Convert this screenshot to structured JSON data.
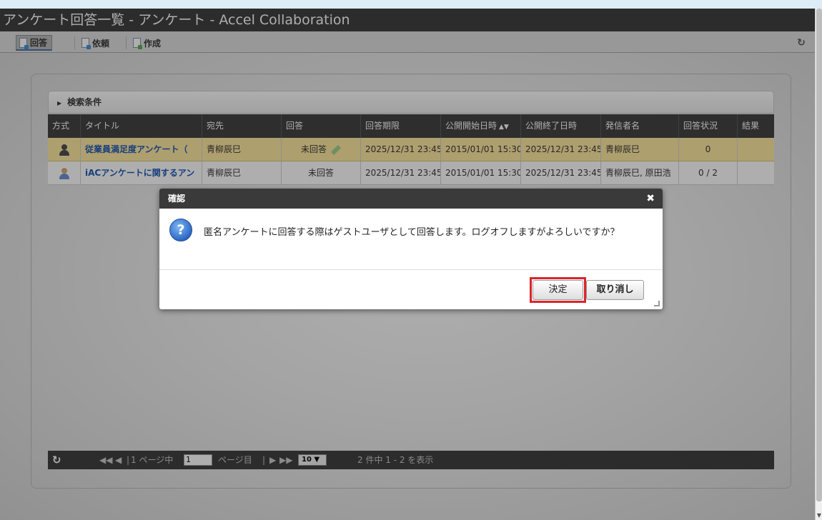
{
  "window": {
    "title": "アンケート回答一覧 - アンケート - Accel Collaboration"
  },
  "tabs": [
    {
      "label": "回答",
      "active": true
    },
    {
      "label": "依頼",
      "active": false
    },
    {
      "label": "作成",
      "active": false
    }
  ],
  "search": {
    "label": "検索条件"
  },
  "grid": {
    "columns": [
      "方式",
      "タイトル",
      "宛先",
      "回答",
      "回答期限",
      "公開開始日時",
      "公開終了日時",
      "発信者名",
      "回答状況",
      "結果"
    ],
    "sort_icon": "sort-icon",
    "rows": [
      {
        "method_icon": "person-icon",
        "title": "従業員満足度アンケート（",
        "recipient": "青柳辰巳",
        "answer": "未回答",
        "deadline": "2025/12/31 23:45",
        "start": "2015/01/01 15:30",
        "end": "2025/12/31 23:45",
        "sender": "青柳辰巳",
        "status": "0",
        "result": ""
      },
      {
        "method_icon": "person-icon",
        "title": "iACアンケートに関するアン",
        "recipient": "青柳辰巳",
        "answer": "未回答",
        "deadline": "2025/12/31 23:45",
        "start": "2015/01/01 15:30",
        "end": "2025/12/31 23:45",
        "sender": "青柳辰巳, 原田浩",
        "status": "0 / 2",
        "result": ""
      }
    ]
  },
  "pager": {
    "page_prefix": "1 ページ中",
    "page_value": "1",
    "page_suffix": "ページ目",
    "page_size": "10 ▼",
    "summary": "2 件中 1 - 2 を表示"
  },
  "dialog": {
    "title": "確認",
    "close": "✖",
    "message": "匿名アンケートに回答する際はゲストユーザとして回答します。ログオフしますがよろしいですか？",
    "ok_label": "決定",
    "cancel_label": "取り消し"
  },
  "colors": {
    "highlight": "#d9262c",
    "row_selected": "#ffe8a0",
    "header": "#3e3e3e"
  }
}
